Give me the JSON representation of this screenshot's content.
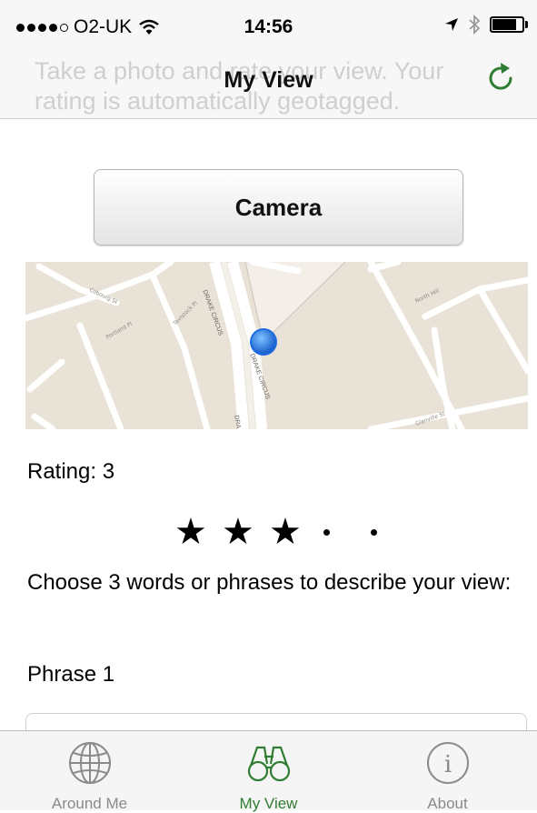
{
  "status_bar": {
    "carrier": "O2-UK",
    "time": "14:56"
  },
  "nav": {
    "title": "My View",
    "ghost_text": "Take a photo and rate your view. Your rating is automatically geotagged."
  },
  "camera_button": {
    "label": "Camera"
  },
  "map": {
    "street_labels": [
      "DRAKE CIRCUS",
      "DRAKE CIRCUS",
      "DRA"
    ]
  },
  "rating": {
    "label": "Rating: 3",
    "value": 3,
    "max": 5
  },
  "describe": {
    "label": "Choose 3 words or phrases to describe your view:"
  },
  "phrase1": {
    "label": "Phrase 1",
    "value": ""
  },
  "tabs": [
    {
      "label": "Around Me",
      "icon": "globe-icon",
      "active": false
    },
    {
      "label": "My View",
      "icon": "binoculars-icon",
      "active": true
    },
    {
      "label": "About",
      "icon": "info-icon",
      "active": false
    }
  ],
  "colors": {
    "accent": "#2e7d32",
    "map_background": "#e9e2d6",
    "location_dot": "#1e6be0"
  }
}
